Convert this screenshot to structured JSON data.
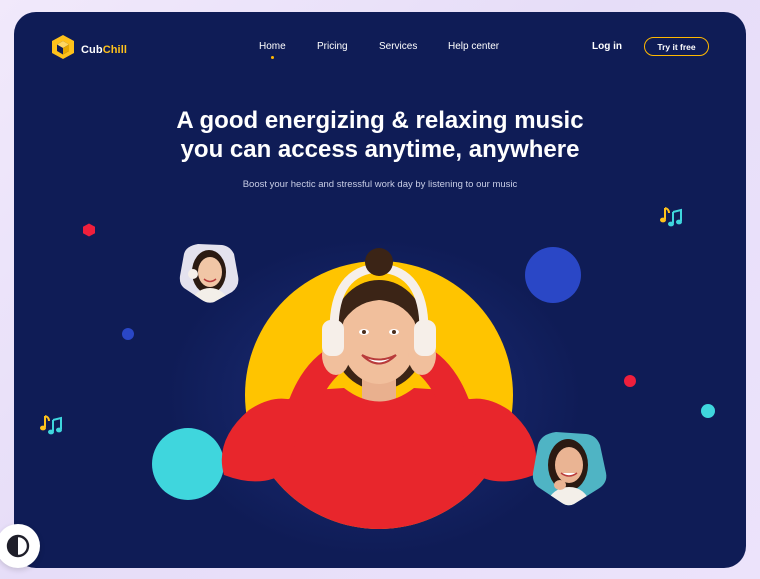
{
  "brand": {
    "name_part1": "Cub",
    "name_part2": "Chill",
    "accent_color": "#ffc21b"
  },
  "nav": {
    "items": [
      {
        "label": "Home",
        "active": true
      },
      {
        "label": "Pricing",
        "active": false
      },
      {
        "label": "Services",
        "active": false
      },
      {
        "label": "Help center",
        "active": false
      }
    ],
    "login_label": "Log in",
    "cta_label": "Try it free"
  },
  "hero": {
    "headline_line1": "A good energizing & relaxing music",
    "headline_line2": "you can access anytime, anywhere",
    "subtitle": "Boost your hectic and stressful work day by listening to our music"
  },
  "colors": {
    "background": "#0f1c56",
    "yellow": "#ffc400",
    "cyan": "#3fd6dd",
    "blue": "#2a47c6",
    "red": "#ef1f3c",
    "sweater": "#e8262c"
  },
  "icons": {
    "logo": "hexagon-cube-icon",
    "note": "music-notes-icon",
    "toggle": "contrast-icon"
  }
}
